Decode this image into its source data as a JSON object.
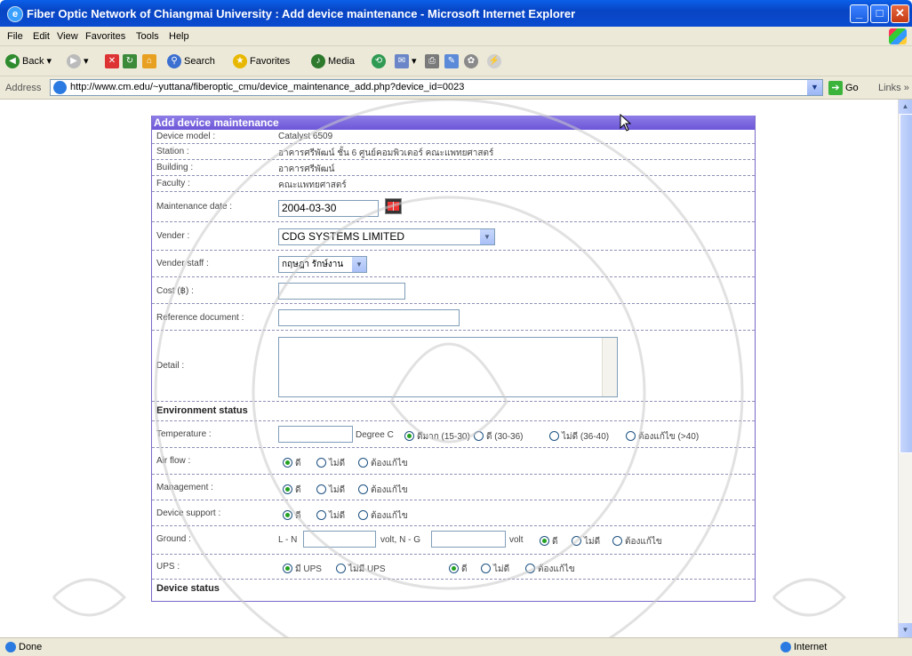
{
  "window": {
    "title": "Fiber Optic Network of Chiangmai University : Add device maintenance - Microsoft Internet Explorer"
  },
  "menu": [
    "File",
    "Edit",
    "View",
    "Favorites",
    "Tools",
    "Help"
  ],
  "toolbar": {
    "back": "Back",
    "search": "Search",
    "favorites": "Favorites",
    "media": "Media"
  },
  "address": {
    "label": "Address",
    "url": "http://www.cm.edu/~yuttana/fiberoptic_cmu/device_maintenance_add.php?device_id=0023",
    "go": "Go",
    "links": "Links"
  },
  "status": {
    "left": "Done",
    "zone": "Internet"
  },
  "form": {
    "heading": "Add device maintenance",
    "device_model": {
      "label": "Device model :",
      "value": "Catalyst 6509"
    },
    "station": {
      "label": "Station :",
      "value": "อาคารศรีพัฒน์ ชั้น 6 ศูนย์คอมพิวเตอร์ คณะแพทยศาสตร์"
    },
    "building": {
      "label": "Building :",
      "value": "อาคารศรีพัฒน์"
    },
    "faculty": {
      "label": "Faculty :",
      "value": "คณะแพทยศาสตร์"
    },
    "maintenance_date": {
      "label": "Maintenance date :",
      "value": "2004-03-30"
    },
    "vender": {
      "label": "Vender :",
      "value": "CDG SYSTEMS LIMITED"
    },
    "vender_staff": {
      "label": "Vender staff :",
      "value": "กฤษฎา รักษ์งาน"
    },
    "cost": {
      "label": "Cost (฿) :",
      "value": ""
    },
    "reference": {
      "label": "Reference document :",
      "value": ""
    },
    "detail": {
      "label": "Detail :",
      "value": ""
    },
    "env_section": "Environment status",
    "temperature": {
      "label": "Temperature :",
      "value": "",
      "unit": "Degree C",
      "options": [
        "ดีมาก (15-30)",
        "ดี (30-36)",
        "ไม่ดี (36-40)",
        "ต้องแก้ไข (>40)"
      ],
      "selected": 0
    },
    "air_flow": {
      "label": "Air flow :",
      "options": [
        "ดี",
        "ไม่ดี",
        "ต้องแก้ไข"
      ],
      "selected": 0
    },
    "management": {
      "label": "Management :",
      "options": [
        "ดี",
        "ไม่ดี",
        "ต้องแก้ไข"
      ],
      "selected": 0
    },
    "device_support": {
      "label": "Device support :",
      "options": [
        "ดี",
        "ไม่ดี",
        "ต้องแก้ไข"
      ],
      "selected": 0
    },
    "ground": {
      "label": "Ground :",
      "ln_label": "L - N",
      "ln_value": "",
      "volt1": "volt, N - G",
      "ng_value": "",
      "volt2": "volt",
      "options": [
        "ดี",
        "ไม่ดี",
        "ต้องแก้ไข"
      ],
      "selected": 0
    },
    "ups": {
      "label": "UPS :",
      "presence": [
        "มี UPS",
        "ไม่มี UPS"
      ],
      "presence_selected": 0,
      "options": [
        "ดี",
        "ไม่ดี",
        "ต้องแก้ไข"
      ],
      "selected": 0
    },
    "device_section": "Device status"
  }
}
